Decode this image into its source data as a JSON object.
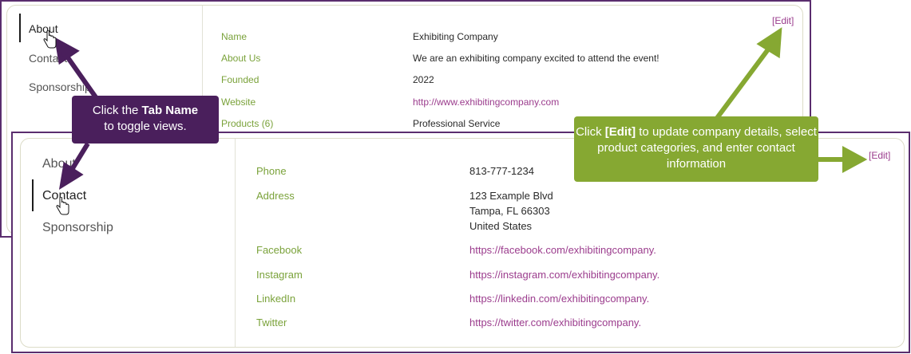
{
  "top_panel": {
    "tabs": [
      {
        "label": "About",
        "active": true
      },
      {
        "label": "Contact",
        "active": false
      },
      {
        "label": "Sponsorship",
        "active": false
      }
    ],
    "edit_label": "[Edit]",
    "fields": [
      {
        "label": "Name",
        "value": "Exhibiting Company"
      },
      {
        "label": "About Us",
        "value": "We are an exhibiting company excited to attend the event!"
      },
      {
        "label": "Founded",
        "value": "2022"
      },
      {
        "label": "Website",
        "value": "http://www.exhibitingcompany.com"
      },
      {
        "label": "Products (6)",
        "value": "Professional Service"
      }
    ]
  },
  "bottom_panel": {
    "tabs": [
      {
        "label": "About",
        "active": false
      },
      {
        "label": "Contact",
        "active": true
      },
      {
        "label": "Sponsorship",
        "active": false
      }
    ],
    "edit_label": "[Edit]",
    "fields": [
      {
        "label": "Phone",
        "value": "813-777-1234"
      },
      {
        "label": "Address",
        "lines": [
          "123 Example Blvd",
          "Tampa, FL 66303",
          "United States"
        ]
      },
      {
        "label": "Facebook",
        "value": "https://facebook.com/exhibitingcompany."
      },
      {
        "label": "Instagram",
        "value": "https://instagram.com/exhibitingcompany."
      },
      {
        "label": "LinkedIn",
        "value": "https://linkedin.com/exhibitingcompany."
      },
      {
        "label": "Twitter",
        "value": "https://twitter.com/exhibitingcompany."
      }
    ]
  },
  "callouts": {
    "tab": {
      "prefix": "Click the ",
      "bold": "Tab Name",
      "suffix": "to toggle views."
    },
    "edit": {
      "prefix": "Click ",
      "bold": "[Edit]",
      "suffix": " to update company details, select product categories, and enter contact information"
    }
  },
  "colors": {
    "frame": "#5a2d6e",
    "label_green": "#7aa23a",
    "link_purple": "#9b3c8d",
    "callout_purple": "#4a1f5c",
    "callout_green": "#86a832"
  },
  "icons": {
    "cursor": "hand-pointer-icon"
  }
}
